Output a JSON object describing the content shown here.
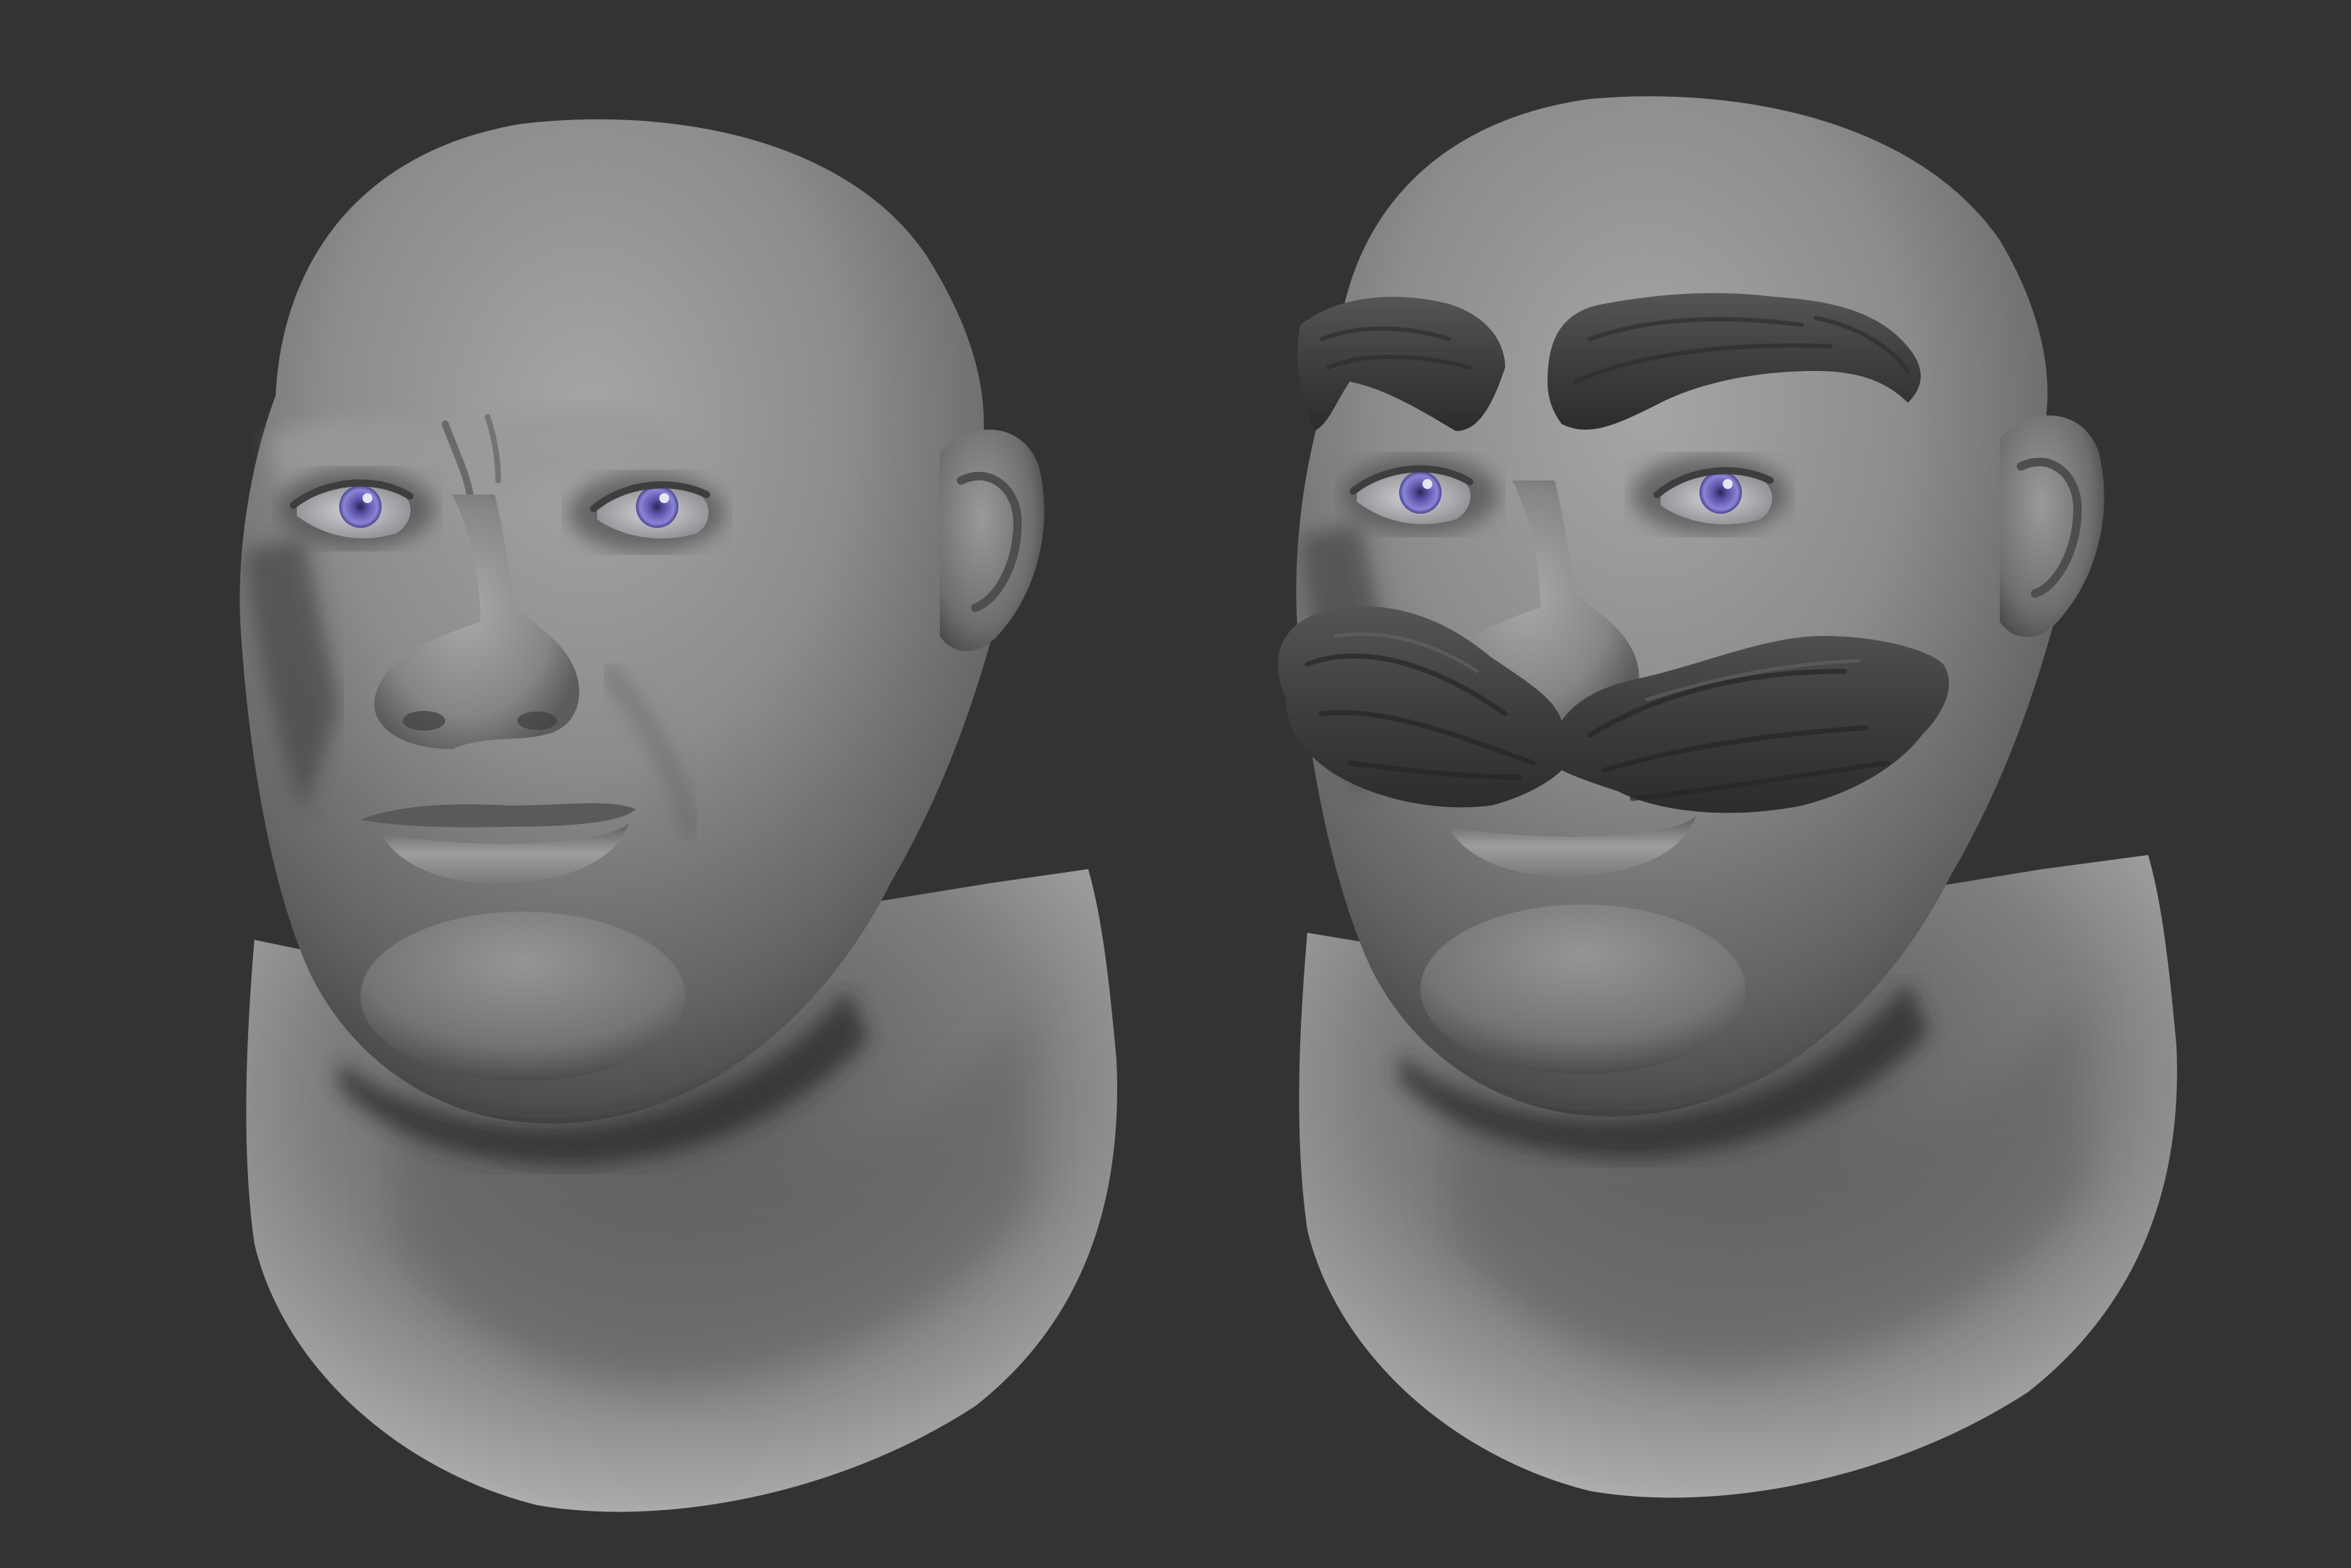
{
  "scene": {
    "background_color": "#333335",
    "clay_light": "#b9b9b9",
    "clay_mid": "#8a8a8a",
    "clay_shadow": "#4a4a4a",
    "hair_color": "#3c3c3c",
    "iris_color": "#6a63b8",
    "iris_highlight": "#9a92e0",
    "subjects": [
      {
        "id": "bald-head",
        "has_eyebrows": false,
        "has_mustache": false
      },
      {
        "id": "mustache-head",
        "has_eyebrows": true,
        "has_mustache": true
      }
    ]
  }
}
